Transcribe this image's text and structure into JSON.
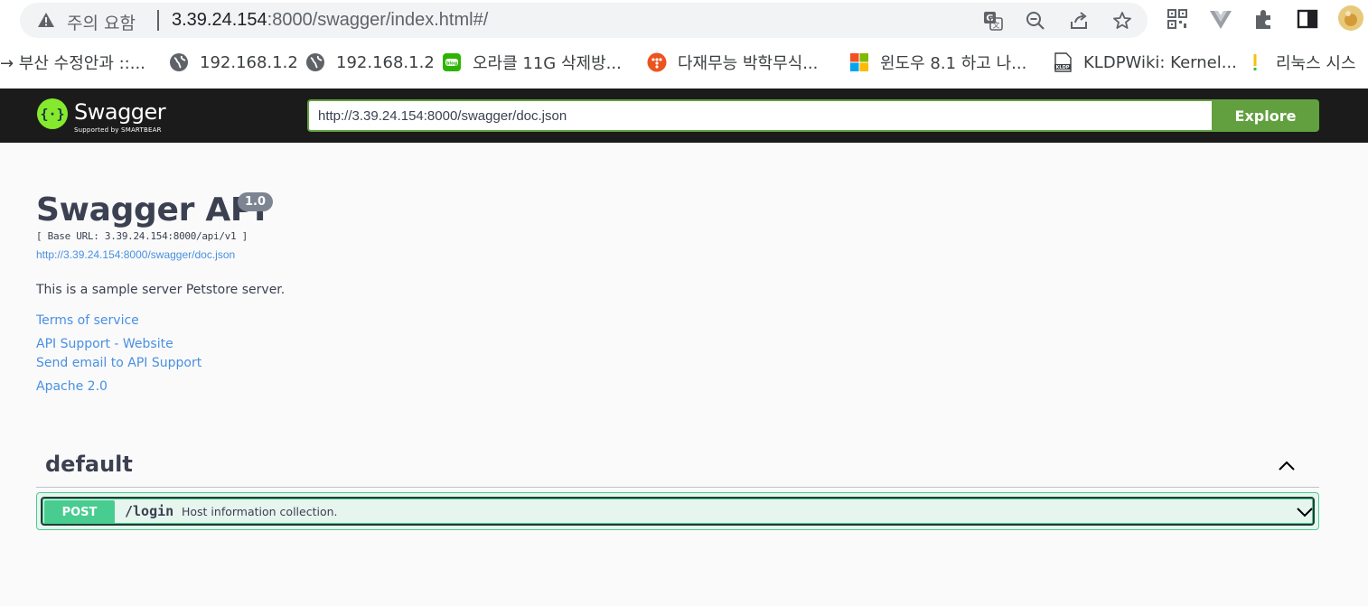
{
  "browser": {
    "security_label": "주의 요함",
    "url_host": "3.39.24.154",
    "url_rest": ":8000/swagger/index.html#/",
    "bookmarks": [
      {
        "label": "→ 부산 수정안과 ::...",
        "icon": "arrow-icon"
      },
      {
        "label": "192.168.1.2",
        "icon": "globe-icon"
      },
      {
        "label": "192.168.1.2",
        "icon": "globe-icon"
      },
      {
        "label": "오라클 11G 삭제방...",
        "icon": "blog-icon"
      },
      {
        "label": "다재무능 박학무식...",
        "icon": "tistory-icon"
      },
      {
        "label": "윈도우 8.1 하고 나...",
        "icon": "windows-icon"
      },
      {
        "label": "KLDPWiki: Kernel...",
        "icon": "kldp-icon"
      },
      {
        "label": "리눅스 시스",
        "icon": "exclamation-icon"
      }
    ]
  },
  "topbar": {
    "logo_text": "Swagger",
    "logo_sub": "Supported by SMARTBEAR",
    "spec_url": "http://3.39.24.154:8000/swagger/doc.json",
    "explore_label": "Explore"
  },
  "info": {
    "title": "Swagger API",
    "version": "1.0",
    "base_url": "[ Base URL: 3.39.24.154:8000/api/v1 ]",
    "spec_link": "http://3.39.24.154:8000/swagger/doc.json",
    "description": "This is a sample server Petstore server.",
    "terms": "Terms of service",
    "support_website": "API Support - Website",
    "support_email": "Send email to API Support",
    "license": "Apache 2.0"
  },
  "operations": {
    "tag": "default",
    "items": [
      {
        "method": "POST",
        "path": "/login",
        "summary": "Host information collection."
      }
    ]
  },
  "colors": {
    "topbar_bg": "#1b1b1b",
    "brand_green": "#62a03f",
    "post_green": "#49cc90",
    "link_blue": "#4990e2",
    "text": "#3b4151"
  }
}
